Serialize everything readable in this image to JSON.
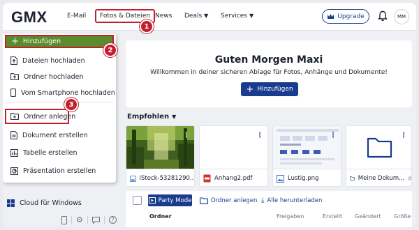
{
  "header": {
    "logo": "GMX",
    "nav": [
      {
        "label": "E-Mail"
      },
      {
        "label": "Fotos & Dateien"
      },
      {
        "label": "News"
      },
      {
        "label": "Deals"
      },
      {
        "label": "Services"
      }
    ],
    "upgrade_label": "Upgrade",
    "avatar_initials": "MM"
  },
  "steps": [
    "1",
    "2",
    "3"
  ],
  "menu": {
    "add_label": "Hinzufügen",
    "items": [
      {
        "label": "Dateien hochladen",
        "icon": "file-upload-icon"
      },
      {
        "label": "Ordner hochladen",
        "icon": "folder-upload-icon"
      },
      {
        "label": "Vom Smartphone hochladen",
        "icon": "smartphone-icon"
      },
      {
        "label": "Ordner anlegen",
        "icon": "folder-add-icon"
      },
      {
        "label": "Dokument erstellen",
        "icon": "document-icon"
      },
      {
        "label": "Tabelle erstellen",
        "icon": "spreadsheet-icon"
      },
      {
        "label": "Präsentation erstellen",
        "icon": "presentation-icon"
      }
    ]
  },
  "sidebar": {
    "cloud_label": "Cloud für Windows"
  },
  "welcome": {
    "title": "Guten Morgen Maxi",
    "subtitle": "Willkommen in deiner sicheren Ablage für Fotos, Anhänge und Dokumente!",
    "add_label": "Hinzufügen"
  },
  "recommended": {
    "heading": "Empfohlen",
    "cards": [
      {
        "name": "iStock-53281290..."
      },
      {
        "name": "Anhang2.pdf"
      },
      {
        "name": "Lustig.png"
      },
      {
        "name": "Meine Dokum..."
      }
    ]
  },
  "toolbar": {
    "party_mode": "Party Mode",
    "create_folder": "Ordner anlegen",
    "download_all": "Alle herunterladen"
  },
  "columns": {
    "name": "Ordner",
    "shared": "Freigaben",
    "created": "Erstellt",
    "modified": "Geändert",
    "size": "Größe"
  },
  "colors": {
    "brand": "#1a3c8f",
    "add_green": "#5a8c2d",
    "highlight_red": "#c2202e"
  }
}
